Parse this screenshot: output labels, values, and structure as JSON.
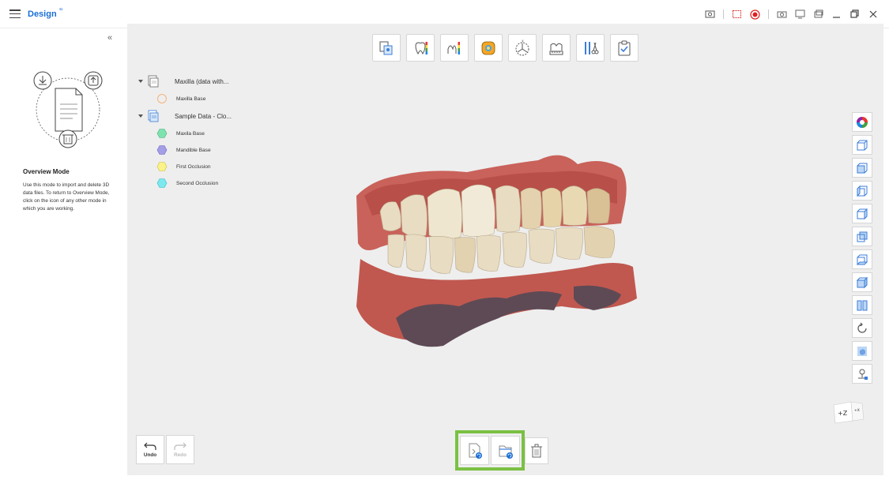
{
  "app": {
    "title": "Design",
    "title_sup": "³¹"
  },
  "left_panel": {
    "collapse_glyph": "«",
    "mode_title": "Overview Mode",
    "mode_description": "Use this mode to import and delete 3D data files. To return to Overview Mode, click on the icon of any other mode in which you are working."
  },
  "tree": {
    "groups": [
      {
        "label": "Maxilla (data with...",
        "items": [
          {
            "label": "Maxilla Base",
            "color": "#f5b37a",
            "shape": "circle"
          }
        ]
      },
      {
        "label": "Sample Data - Clo...",
        "items": [
          {
            "label": "Maxila Base",
            "color": "#7fe3b0",
            "shape": "hexagon"
          },
          {
            "label": "Mandible Base",
            "color": "#a49ee6",
            "shape": "hexagon"
          },
          {
            "label": "First Occlusion",
            "color": "#fbf28a",
            "shape": "hexagon"
          },
          {
            "label": "Second Occlusion",
            "color": "#7ce9ef",
            "shape": "hexagon"
          }
        ]
      }
    ]
  },
  "bottom": {
    "undo_label": "Undo",
    "redo_label": "Redo"
  },
  "orientation": {
    "z_label": "+Z",
    "x_label": "+X"
  },
  "colors": {
    "accent": "#1a6fd6",
    "highlight": "#7ac143",
    "record": "#e02020"
  }
}
